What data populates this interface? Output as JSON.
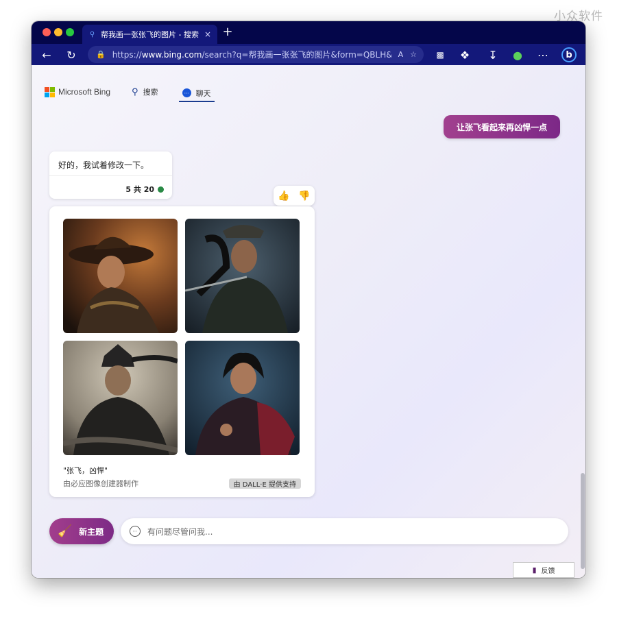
{
  "watermark": "小众软件",
  "browser": {
    "tab_title": "帮我画一张张飞的图片 - 搜索",
    "tab_close": "×",
    "new_tab": "+",
    "address": {
      "prefix": "https://",
      "host": "www.bing.com",
      "path": "/search?q=帮我画一张张飞的图片&form=QBLH&s..."
    },
    "toolbar_icons": [
      "back-icon",
      "refresh-icon",
      "lock-icon",
      "read-aloud-icon",
      "favorites-icon",
      "extension-icon",
      "puzzle-icon",
      "download-icon",
      "profile-icon",
      "more-icon",
      "bing-icon"
    ]
  },
  "header": {
    "brand": "Microsoft Bing",
    "logo_colors": [
      "#f25022",
      "#7fba00",
      "#00a4ef",
      "#ffb900"
    ],
    "tabs": [
      {
        "label": "搜索",
        "icon": "search-icon"
      },
      {
        "label": "聊天",
        "icon": "chat-icon",
        "active": true
      }
    ]
  },
  "conversation": {
    "user_message": "让张飞看起来再凶悍一点",
    "bot_message": "好的，我试着修改一下。",
    "bot_count": "5 共 20",
    "image_card": {
      "caption": "\"张飞，凶悍\"",
      "subcaption": "由必应图像创建器制作",
      "badge": "由 DALL·E 提供支持"
    }
  },
  "composer": {
    "new_topic_label": "新主题",
    "placeholder": "有问题尽管问我..."
  },
  "feedback_button": "反馈",
  "colors": {
    "tab_bar": "#04064a",
    "toolbar": "#13187a",
    "accent": "#8f358a",
    "active_tab_underline": "#1a3c8f"
  }
}
